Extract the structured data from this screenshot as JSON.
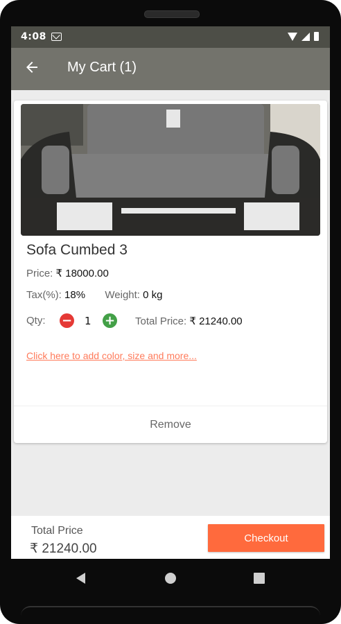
{
  "status": {
    "time": "4:08"
  },
  "appbar": {
    "title": "My Cart (1)"
  },
  "item": {
    "name": "Sofa Cumbed 3",
    "price_label": "Price:",
    "price_value": "₹ 18000.00",
    "tax_label": "Tax(%):",
    "tax_value": "18%",
    "weight_label": "Weight:",
    "weight_value": "0 kg",
    "qty_label": "Qty:",
    "qty_value": "1",
    "total_label": "Total Price:",
    "total_value": "₹ 21240.00",
    "options_link": "Click here to add color, size and more...",
    "remove_label": "Remove"
  },
  "footer": {
    "total_label": "Total Price",
    "total_value": "₹ 21240.00",
    "checkout_label": "Checkout"
  },
  "colors": {
    "appbar": "#73736c",
    "statusbar": "#4d4e47",
    "checkout": "#ff6a3d",
    "link": "#ff7a5a",
    "minus": "#e53935",
    "plus": "#43a047"
  }
}
